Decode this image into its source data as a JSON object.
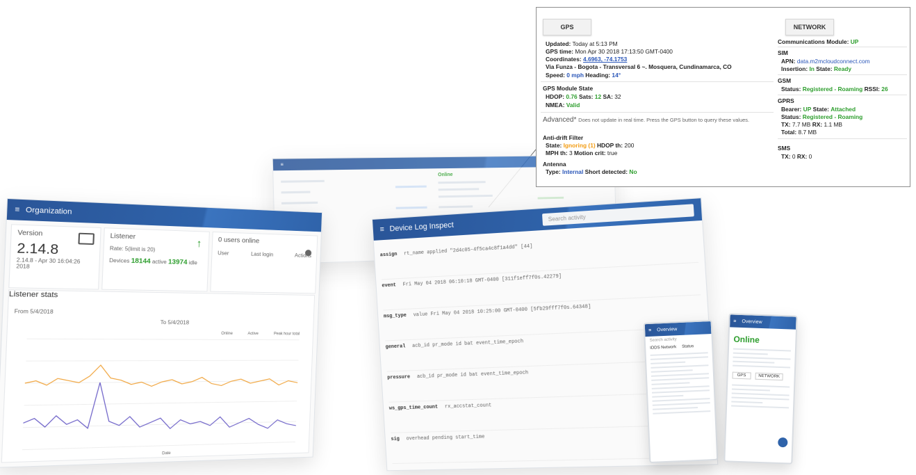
{
  "left_panel": {
    "appbar_title": "Organization",
    "version": {
      "label": "Version",
      "value": "2.14.8",
      "sub": "2.14.8 - Apr 30 16:04:26 2018"
    },
    "listener": {
      "label": "Listener",
      "rate": "Rate: 5(limit is 20)",
      "devices_label": "Devices",
      "online": "18144",
      "online_label": "active",
      "idle": "13974",
      "idle_label": "idle"
    },
    "users": {
      "label": "0 users online",
      "col1": "User",
      "col2": "Last login",
      "col3": "Actions"
    },
    "stats": {
      "label": "Listener stats",
      "from_label": "From",
      "from": "5/4/2018",
      "to_label": "To",
      "to": "5/4/2018"
    },
    "chart_data": {
      "type": "line",
      "title": "Listener stats",
      "xlabel": "Date",
      "legend": [
        "Online",
        "Active",
        "Peak hour total"
      ],
      "series": [
        {
          "name": "Online",
          "values": [
            30,
            31,
            29,
            32,
            31,
            30,
            33,
            38,
            32,
            31,
            29,
            30,
            28,
            30,
            31,
            29,
            30,
            32,
            29,
            28,
            30,
            31,
            29,
            30,
            31,
            28,
            30,
            29
          ]
        },
        {
          "name": "Active",
          "values": [
            12,
            14,
            10,
            15,
            11,
            13,
            9,
            30,
            12,
            10,
            14,
            9,
            11,
            13,
            8,
            12,
            10,
            11,
            9,
            13,
            8,
            10,
            12,
            9,
            7,
            11,
            9,
            8
          ]
        }
      ],
      "ylim": [
        0,
        50
      ]
    }
  },
  "back_panel": {
    "status": "Online"
  },
  "mid_panel": {
    "appbar_title": "Device Log Inspect",
    "search_placeholder": "Search activity",
    "rows": [
      {
        "k": "assign",
        "v": "rt_name  applied  \"2d4c05-4f5ca4c8f1a4dd\"  [44]"
      },
      {
        "k": "event",
        "v": "Fri May 04 2018 06:10:18 GMT-0400  [311f1eff7f0s.42279]"
      },
      {
        "k": "msg_type",
        "v": "value   Fri May 04 2018 10:25:00 GMT-0400  [5fb29fff7f0s.64348]"
      },
      {
        "k": "general",
        "v": "acb_id  pr_mode  id  bat  event_time_epoch"
      },
      {
        "k": "pressure",
        "v": "acb_id  pr_mode  id  bat  event_time_epoch"
      },
      {
        "k": "ws_gps_time_count",
        "v": "rx_accstat_count"
      },
      {
        "k": "sig",
        "v": "overhead  pending  start_time"
      }
    ]
  },
  "phones": {
    "p1": {
      "appbar": "Overview",
      "search": "Search activity",
      "tab1": "IDDS Network",
      "tab2": "Status"
    },
    "p2": {
      "appbar": "Overview",
      "status": "Online",
      "gps_btn": "GPS",
      "net_btn": "NETWORK"
    }
  },
  "callout": {
    "gps_button": "GPS",
    "network_button": "NETWORK",
    "updated_label": "Updated:",
    "updated": "Today at 5:13 PM",
    "gps_time_label": "GPS time:",
    "gps_time": "Mon Apr 30 2018 17:13:50 GMT-0400",
    "coords_label": "Coordinates:",
    "coords": "4.6963, -74.1753",
    "address": "Via Funza - Bogota - Transversal 6 ~. Mosquera, Cundinamarca, CO",
    "speed_label": "Speed:",
    "speed": "0 mph",
    "heading_label": "Heading:",
    "heading": "14°",
    "gps_module_header": "GPS Module State",
    "hdop_label": "HDOP:",
    "hdop": "0.76",
    "sats_label": "Sats:",
    "sats": "12",
    "sa_label": "SA:",
    "sa": "32",
    "nmea_label": "NMEA:",
    "nmea": "Valid",
    "advanced_label": "Advanced*",
    "advanced_note": "Does not update in real time. Press the GPS button to query these values.",
    "antidrift_header": "Anti-drift Filter",
    "state_label": "State:",
    "state": "Ignoring (1)",
    "hdop_th_label": "HDOP th:",
    "hdop_th": "200",
    "mph_th_label": "MPH th:",
    "mph_th": "3",
    "motion_label": "Motion crit:",
    "motion": "true",
    "antenna_header": "Antenna",
    "type_label": "Type:",
    "type": "Internal",
    "short_label": "Short detected:",
    "short": "No",
    "comm_label": "Communications Module:",
    "comm": "UP",
    "sim_header": "SIM",
    "apn_label": "APN:",
    "apn": "data.m2mcloudconnect.com",
    "insertion_label": "Insertion:",
    "insertion": "In",
    "sim_state_label": "State:",
    "sim_state": "Ready",
    "gsm_header": "GSM",
    "gsm_status_label": "Status:",
    "gsm_status": "Registered - Roaming",
    "rssi_label": "RSSI:",
    "rssi": "26",
    "gprs_header": "GPRS",
    "bearer_label": "Bearer:",
    "bearer": "UP",
    "gprs_state_label": "State:",
    "gprs_state": "Attached",
    "gprs_status_label": "Status:",
    "gprs_status": "Registered - Roaming",
    "tx_label": "TX:",
    "tx": "7.7 MB",
    "rx_label": "RX:",
    "rx": "1.1 MB",
    "total_label": "Total:",
    "total": "8.7 MB",
    "sms_header": "SMS",
    "sms_tx_label": "TX:",
    "sms_tx": "0",
    "sms_rx_label": "RX:",
    "sms_rx": "0"
  }
}
